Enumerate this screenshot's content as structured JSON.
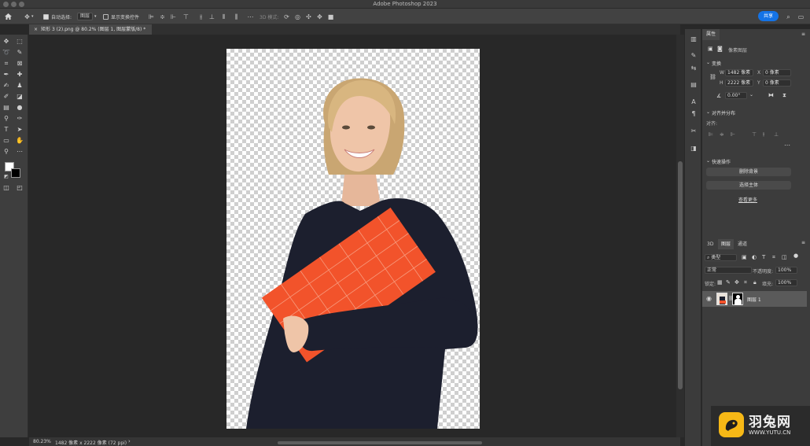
{
  "window": {
    "title": "Adobe Photoshop 2023"
  },
  "options_bar": {
    "auto_select_label": "自动选择:",
    "auto_select_value": "图层",
    "show_transform_label": "显示变换控件",
    "mode_3d_label": "3D 模式:",
    "share_label": "共享"
  },
  "document_tab": {
    "title": "矩形 3 (2).png @ 80.2% (图层 1, 图层蒙版/8) *"
  },
  "status_bar": {
    "zoom": "80.23%",
    "doc_info": "1482 像素 x 2222 像素 (72 ppi)"
  },
  "properties_panel": {
    "tab_label": "属性",
    "pixel_layer_label": "像素图层",
    "transform_title": "变换",
    "w_label": "W",
    "w_value": "1482 像素",
    "x_label": "X",
    "x_value": "0 像素",
    "h_label": "H",
    "h_value": "2222 像素",
    "y_label": "Y",
    "y_value": "0 像素",
    "angle_value": "0.00°",
    "align_title": "对齐并分布",
    "align_to_label": "对齐:",
    "quick_actions_title": "快速操作",
    "remove_bg_label": "删除背景",
    "select_subject_label": "选择主体",
    "view_more_label": "查看更多"
  },
  "layers_panel": {
    "tabs": [
      {
        "label": "3D"
      },
      {
        "label": "图层"
      },
      {
        "label": "通道"
      }
    ],
    "filter_kind": "类型",
    "blend_mode": "正常",
    "opacity_label": "不透明度:",
    "opacity_value": "100%",
    "lock_label": "锁定:",
    "fill_label": "填充:",
    "fill_value": "100%",
    "layers": [
      {
        "name": "图层 1"
      }
    ]
  },
  "watermark": {
    "brand_cn": "羽兔网",
    "url": "WWW.YUTU.CN"
  },
  "colors": {
    "share_button": "#1473e6",
    "folder_orange": "#f2532b",
    "sweater": "#1c1f2e"
  }
}
